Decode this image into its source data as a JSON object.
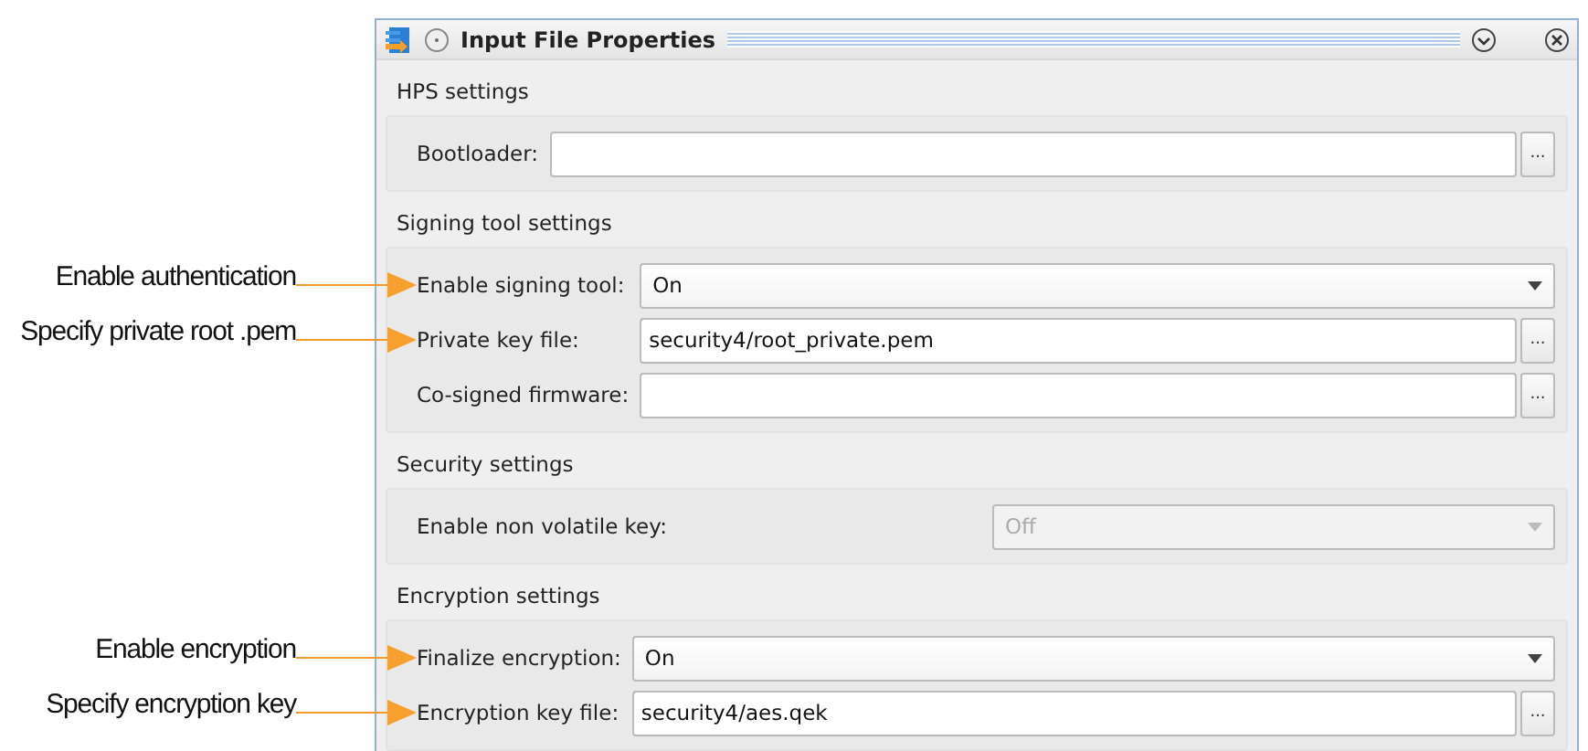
{
  "window": {
    "title": "Input File Properties"
  },
  "sections": [
    {
      "title": "HPS settings",
      "fields": [
        {
          "kind": "file",
          "label": "Bootloader:",
          "browse": "..."
        }
      ]
    },
    {
      "title": "Signing tool settings",
      "fields": [
        {
          "kind": "dropdown",
          "label": "Enable signing tool:",
          "value": "On",
          "disabled": false,
          "callout": "Enable authentication"
        },
        {
          "kind": "file",
          "label": "Private key file:",
          "value": "security4/root_private.pem",
          "browse": "...",
          "callout": "Specify private root .pem"
        },
        {
          "kind": "file",
          "label": "Co-signed firmware:",
          "browse": "..."
        }
      ]
    },
    {
      "title": "Security settings",
      "fields": [
        {
          "kind": "dropdown",
          "label": "Enable non volatile key:",
          "value": "Off",
          "disabled": true
        }
      ]
    },
    {
      "title": "Encryption settings",
      "fields": [
        {
          "kind": "dropdown",
          "label": "Finalize encryption:",
          "value": "On",
          "disabled": false,
          "callout": "Enable encryption"
        },
        {
          "kind": "file",
          "label": "Encryption key file:",
          "value": "security4/aes.qek",
          "browse": "...",
          "callout": "Specify encryption key"
        }
      ]
    }
  ]
}
